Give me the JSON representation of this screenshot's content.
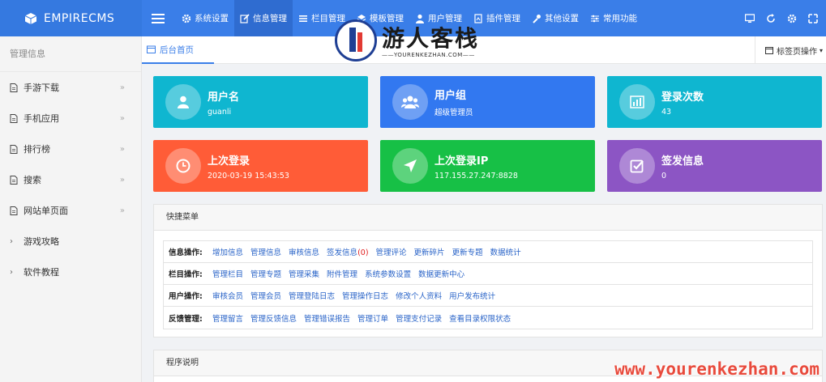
{
  "brand": {
    "name": "EMPIRECMS"
  },
  "nav": {
    "items": [
      {
        "label": "系统设置",
        "icon": "gear-icon"
      },
      {
        "label": "信息管理",
        "icon": "edit-icon",
        "active": true
      },
      {
        "label": "栏目管理",
        "icon": "list-icon"
      },
      {
        "label": "模板管理",
        "icon": "layers-icon"
      },
      {
        "label": "用户管理",
        "icon": "user-icon"
      },
      {
        "label": "插件管理",
        "icon": "plugin-icon"
      },
      {
        "label": "其他设置",
        "icon": "wrench-icon"
      },
      {
        "label": "常用功能",
        "icon": "sliders-icon"
      }
    ]
  },
  "watermark": {
    "title": "游人客栈",
    "sub": "YOURENKEZHAN.COM",
    "url": "www.yourenkezhan.com"
  },
  "sidebar": {
    "title": "管理信息",
    "items": [
      {
        "label": "手游下载",
        "type": "doc"
      },
      {
        "label": "手机应用",
        "type": "doc"
      },
      {
        "label": "排行榜",
        "type": "doc"
      },
      {
        "label": "搜索",
        "type": "doc"
      },
      {
        "label": "网站单页面",
        "type": "doc"
      },
      {
        "label": "游戏攻略",
        "type": "chevron"
      },
      {
        "label": "软件教程",
        "type": "chevron"
      }
    ]
  },
  "tabs": {
    "home": "后台首页",
    "ops": "标签页操作"
  },
  "cards": [
    {
      "title": "用户名",
      "value": "guanli",
      "color": "#0fb6d0",
      "icon": "user-icon"
    },
    {
      "title": "用户组",
      "value": "超级管理员",
      "color": "#3278f0",
      "icon": "users-icon"
    },
    {
      "title": "登录次数",
      "value": "43",
      "color": "#0fb6d0",
      "icon": "chart-icon"
    },
    {
      "title": "上次登录",
      "value": "2020-03-19 15:43:53",
      "color": "#ff5c37",
      "icon": "clock-icon"
    },
    {
      "title": "上次登录IP",
      "value": "117.155.27.247:8828",
      "color": "#17c046",
      "icon": "location-arrow-icon"
    },
    {
      "title": "签发信息",
      "value": "0",
      "color": "#8c55c4",
      "icon": "check-square-icon"
    }
  ],
  "quick": {
    "title": "快捷菜单",
    "rows": [
      {
        "label": "信息操作:",
        "links": [
          "增加信息",
          "管理信息",
          "审核信息",
          "签发信息",
          "管理评论",
          "更新碎片",
          "更新专题",
          "数据统计"
        ],
        "badge": "(0)"
      },
      {
        "label": "栏目操作:",
        "links": [
          "管理栏目",
          "管理专题",
          "管理采集",
          "附件管理",
          "系统参数设置",
          "数据更新中心"
        ]
      },
      {
        "label": "用户操作:",
        "links": [
          "审核会员",
          "管理会员",
          "管理登陆日志",
          "管理操作日志",
          "修改个人资料",
          "用户发布统计"
        ]
      },
      {
        "label": "反馈管理:",
        "links": [
          "管理留言",
          "管理反馈信息",
          "管理错误报告",
          "管理订单",
          "管理支付记录",
          "查看目录权限状态"
        ]
      }
    ]
  },
  "program": {
    "title": "程序说明"
  }
}
